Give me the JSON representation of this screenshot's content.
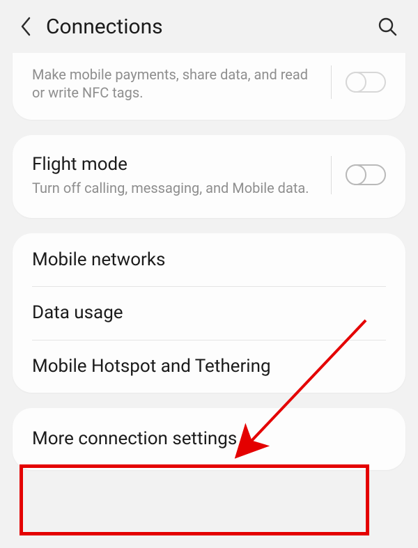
{
  "header": {
    "title": "Connections"
  },
  "nfc_card": {
    "subtitle": "Make mobile payments, share data, and read or write NFC tags."
  },
  "flight_card": {
    "title": "Flight mode",
    "subtitle": "Turn off calling, messaging, and Mobile data."
  },
  "group": {
    "items": [
      {
        "label": "Mobile networks"
      },
      {
        "label": "Data usage"
      },
      {
        "label": "Mobile Hotspot and Tethering"
      }
    ]
  },
  "more_card": {
    "label": "More connection settings"
  },
  "annotation": {
    "highlight_color": "#e40000"
  }
}
